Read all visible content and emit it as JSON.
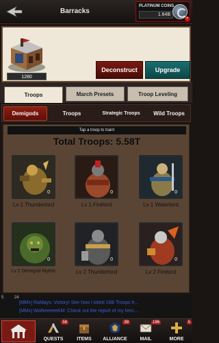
{
  "header": {
    "title": "Barracks",
    "platinum_label": "PLATINUM COINS",
    "platinum_value": "1.64B"
  },
  "building": {
    "level": "1280",
    "deconstruct_label": "Deconstruct",
    "upgrade_label": "Upgrade"
  },
  "main_tabs": [
    "Troops",
    "March Presets",
    "Troop Leveling"
  ],
  "sub_tabs": [
    "Demigods",
    "Troops",
    "Strategic Troops",
    "Wild Troops"
  ],
  "content": {
    "hint": "Tap a troop to train!",
    "total": "Total Troops: 5.58T",
    "troops": [
      {
        "name": "Lv 1 Thunderlord",
        "count": "0",
        "icon": "thunderlord-icon"
      },
      {
        "name": "Lv 1 Firelord",
        "count": "0",
        "icon": "firelord-icon"
      },
      {
        "name": "Lv 1 Waterlord",
        "count": "0",
        "icon": "waterlord-icon"
      },
      {
        "name": "Lv 1 Demigod Mythic",
        "count": "0",
        "icon": "demigod-mythic-icon"
      },
      {
        "name": "Lv 2 Thunderlord",
        "count": "0",
        "icon": "thunderlord-icon"
      },
      {
        "name": "Lv 2 Firelord",
        "count": "0",
        "icon": "firelord-icon"
      }
    ]
  },
  "chat": {
    "online": "5",
    "messages_count": "24",
    "lines": [
      "[MMx] RaMays: Victory! See how I killed 16B Troops fr...",
      "[MMx] WolfieeeeeKM: Check out the report of my fierc..."
    ]
  },
  "nav": {
    "items": [
      {
        "label": "QUESTS",
        "badge": "58",
        "icon": "quests-icon"
      },
      {
        "label": "ITEMS",
        "badge": "",
        "icon": "items-icon"
      },
      {
        "label": "ALLIANCE",
        "badge": "39",
        "icon": "alliance-icon"
      },
      {
        "label": "MAIL",
        "badge": "196",
        "icon": "mail-icon"
      },
      {
        "label": "MORE",
        "badge": "5",
        "icon": "more-icon"
      }
    ]
  }
}
